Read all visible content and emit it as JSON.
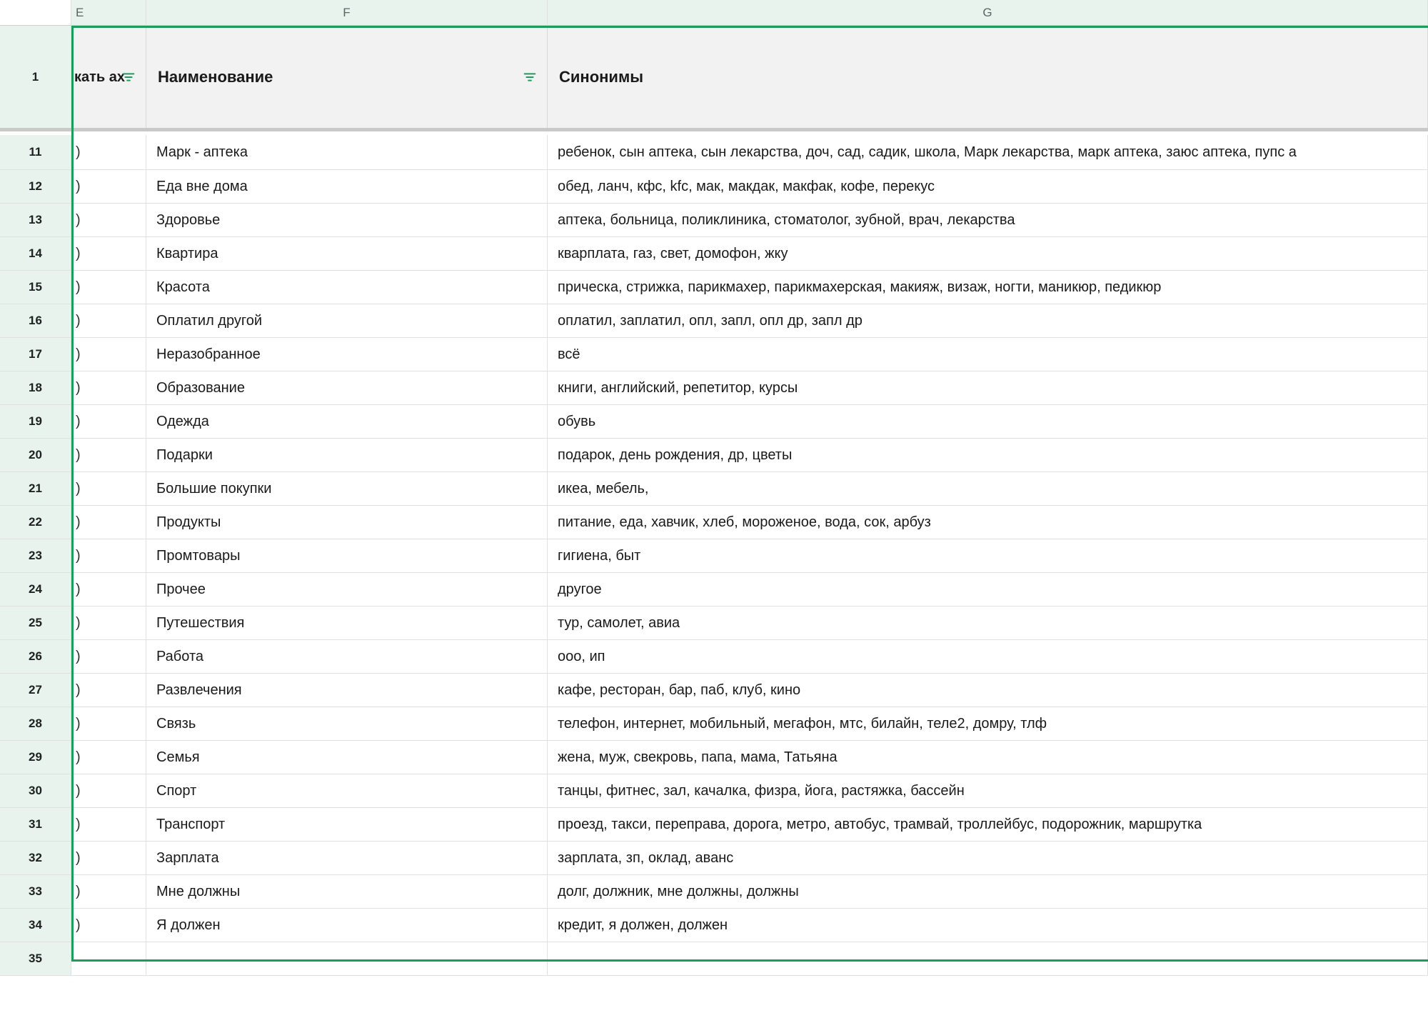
{
  "columns": {
    "e_label": "E",
    "f_label": "F",
    "g_label": "G"
  },
  "header": {
    "row_number": "1",
    "e_header_fragment": "кать ах",
    "f_header": "Наименование",
    "g_header": "Синонимы"
  },
  "e_cell_fragment": ")",
  "rows": [
    {
      "num": "11",
      "name": "Марк - аптека",
      "syn": "ребенок, сын аптека, сын лекарства, доч, сад, садик, школа, Марк лекарства, марк аптека, заюс аптека, пупс а"
    },
    {
      "num": "12",
      "name": "Еда вне дома",
      "syn": "обед, ланч, кфс, kfc, мак, макдак, макфак, кофе, перекус"
    },
    {
      "num": "13",
      "name": "Здоровье",
      "syn": "аптека, больница, поликлиника, стоматолог, зубной, врач, лекарства"
    },
    {
      "num": "14",
      "name": "Квартира",
      "syn": "кварплата, газ, свет, домофон, жку"
    },
    {
      "num": "15",
      "name": "Красота",
      "syn": "прическа, стрижка, парикмахер, парикмахерская, макияж, визаж, ногти, маникюр, педикюр"
    },
    {
      "num": "16",
      "name": "Оплатил другой",
      "syn": "оплатил, заплатил, опл, запл, опл др, запл др"
    },
    {
      "num": "17",
      "name": "Неразобранное",
      "syn": "всё"
    },
    {
      "num": "18",
      "name": "Образование",
      "syn": "книги, английский, репетитор, курсы"
    },
    {
      "num": "19",
      "name": "Одежда",
      "syn": "обувь"
    },
    {
      "num": "20",
      "name": "Подарки",
      "syn": "подарок, день рождения, др, цветы"
    },
    {
      "num": "21",
      "name": "Большие покупки",
      "syn": "икеа, мебель,"
    },
    {
      "num": "22",
      "name": "Продукты",
      "syn": "питание, еда, хавчик, хлеб, мороженое, вода, сок, арбуз"
    },
    {
      "num": "23",
      "name": "Промтовары",
      "syn": "гигиена, быт"
    },
    {
      "num": "24",
      "name": "Прочее",
      "syn": "другое"
    },
    {
      "num": "25",
      "name": "Путешествия",
      "syn": "тур, самолет, авиа"
    },
    {
      "num": "26",
      "name": "Работа",
      "syn": "ооо, ип"
    },
    {
      "num": "27",
      "name": "Развлечения",
      "syn": "кафе, ресторан, бар, паб, клуб, кино"
    },
    {
      "num": "28",
      "name": "Связь",
      "syn": "телефон, интернет, мобильный, мегафон, мтс, билайн, теле2, домру, тлф"
    },
    {
      "num": "29",
      "name": "Семья",
      "syn": "жена, муж, свекровь, папа, мама, Татьяна"
    },
    {
      "num": "30",
      "name": "Спорт",
      "syn": "танцы, фитнес, зал, качалка, физра, йога, растяжка, бассейн"
    },
    {
      "num": "31",
      "name": "Транспорт",
      "syn": "проезд, такси, переправа, дорога, метро, автобус, трамвай, троллейбус, подорожник, маршрутка"
    },
    {
      "num": "32",
      "name": "Зарплата",
      "syn": "зарплата, зп, оклад, аванс"
    },
    {
      "num": "33",
      "name": "Мне должны",
      "syn": "долг, должник, мне должны, должны"
    },
    {
      "num": "34",
      "name": "Я должен",
      "syn": "кредит, я должен, должен"
    }
  ],
  "trailing_rows": [
    {
      "num": "35"
    }
  ]
}
